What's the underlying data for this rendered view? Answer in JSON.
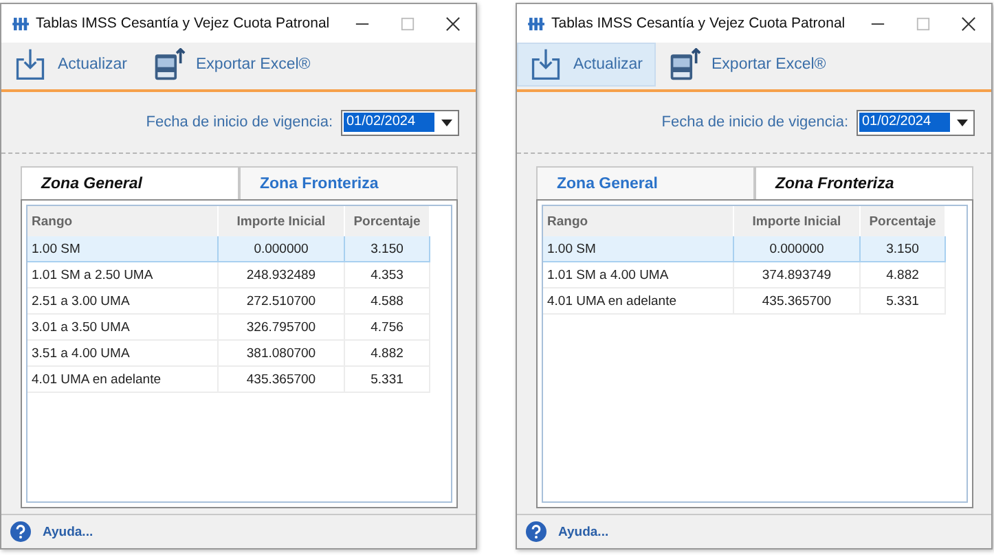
{
  "windows": [
    {
      "title": "Tablas IMSS Cesantía y Vejez Cuota Patronal",
      "toolbar": [
        {
          "kind": "refresh",
          "label": "Actualizar",
          "highlighted": false
        },
        {
          "kind": "export",
          "label": "Exportar Excel®",
          "highlighted": false
        }
      ],
      "date_label": "Fecha de inicio de vigencia:",
      "date_value": "01/02/2024",
      "tabs": [
        {
          "label": "Zona General",
          "selected": true
        },
        {
          "label": "Zona Fronteriza",
          "selected": false
        }
      ],
      "table": {
        "columns": [
          "Rango",
          "Importe Inicial",
          "Porcentaje"
        ],
        "rows": [
          {
            "cells": [
              "1.00 SM",
              "0.000000",
              "3.150"
            ],
            "selected": true
          },
          {
            "cells": [
              "1.01 SM a 2.50 UMA",
              "248.932489",
              "4.353"
            ],
            "selected": false
          },
          {
            "cells": [
              "2.51 a 3.00 UMA",
              "272.510700",
              "4.588"
            ],
            "selected": false
          },
          {
            "cells": [
              "3.01 a 3.50 UMA",
              "326.795700",
              "4.756"
            ],
            "selected": false
          },
          {
            "cells": [
              "3.51 a 4.00 UMA",
              "381.080700",
              "4.882"
            ],
            "selected": false
          },
          {
            "cells": [
              "4.01 UMA en adelante",
              "435.365700",
              "5.331"
            ],
            "selected": false
          }
        ]
      },
      "help": "Ayuda..."
    },
    {
      "title": "Tablas IMSS Cesantía y Vejez Cuota Patronal",
      "toolbar": [
        {
          "kind": "refresh",
          "label": "Actualizar",
          "highlighted": true
        },
        {
          "kind": "export",
          "label": "Exportar Excel®",
          "highlighted": false
        }
      ],
      "date_label": "Fecha de inicio de vigencia:",
      "date_value": "01/02/2024",
      "tabs": [
        {
          "label": "Zona General",
          "selected": false
        },
        {
          "label": "Zona Fronteriza",
          "selected": true
        }
      ],
      "table": {
        "columns": [
          "Rango",
          "Importe Inicial",
          "Porcentaje"
        ],
        "rows": [
          {
            "cells": [
              "1.00 SM",
              "0.000000",
              "3.150"
            ],
            "selected": true
          },
          {
            "cells": [
              "1.01 SM a 4.00 UMA",
              "374.893749",
              "4.882"
            ],
            "selected": false
          },
          {
            "cells": [
              "4.01 UMA en adelante",
              "435.365700",
              "5.331"
            ],
            "selected": false
          }
        ]
      },
      "help": "Ayuda..."
    }
  ]
}
